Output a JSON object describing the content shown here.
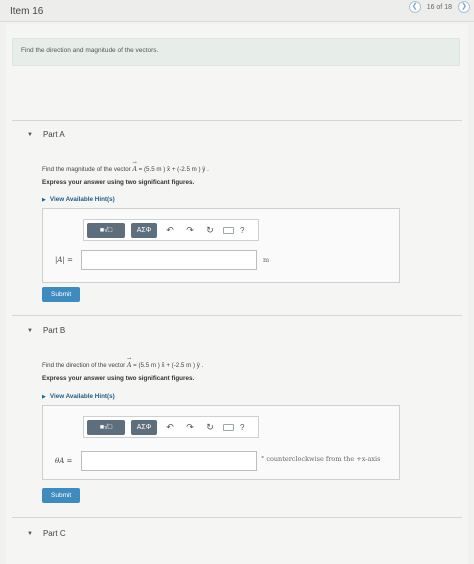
{
  "header": {
    "item_title": "Item 16",
    "pager": {
      "prev_icon": "chevron-left-icon",
      "next_icon": "chevron-right-icon",
      "count": "16 of 18"
    }
  },
  "instruction": "Find the direction and magnitude of the vectors.",
  "parts": [
    {
      "label": "Part A",
      "question_prefix": "Find the magnitude of the vector ",
      "vector_symbol": "A",
      "question_formula": " = (5.5 m ) x̂ + (-2.5 m ) ŷ .",
      "emphasis": "Express your answer using two significant figures.",
      "hint_label": "View Available Hint(s)",
      "toolbar": {
        "template_label": "■√□",
        "greek_label": "ΑΣΦ",
        "help_label": "?"
      },
      "answer_label": "|A| =",
      "answer_value": "",
      "unit": "m",
      "submit_label": "Submit"
    },
    {
      "label": "Part B",
      "question_prefix": "Find the direction of the vector ",
      "vector_symbol": "A",
      "question_formula": " = (5.5 m ) x̂ + (-2.5 m ) ŷ .",
      "emphasis": "Express your answer using two significant figures.",
      "hint_label": "View Available Hint(s)",
      "toolbar": {
        "template_label": "■√□",
        "greek_label": "ΑΣΦ",
        "help_label": "?"
      },
      "answer_label": "θA =",
      "answer_value": "",
      "unit": "° counterclockwise from the +x-axis",
      "submit_label": "Submit"
    },
    {
      "label": "Part C"
    }
  ],
  "colors": {
    "accent": "#3e8bbf",
    "toolbar_button": "#5d6e7c",
    "instruction_bg": "#e7eee9"
  }
}
